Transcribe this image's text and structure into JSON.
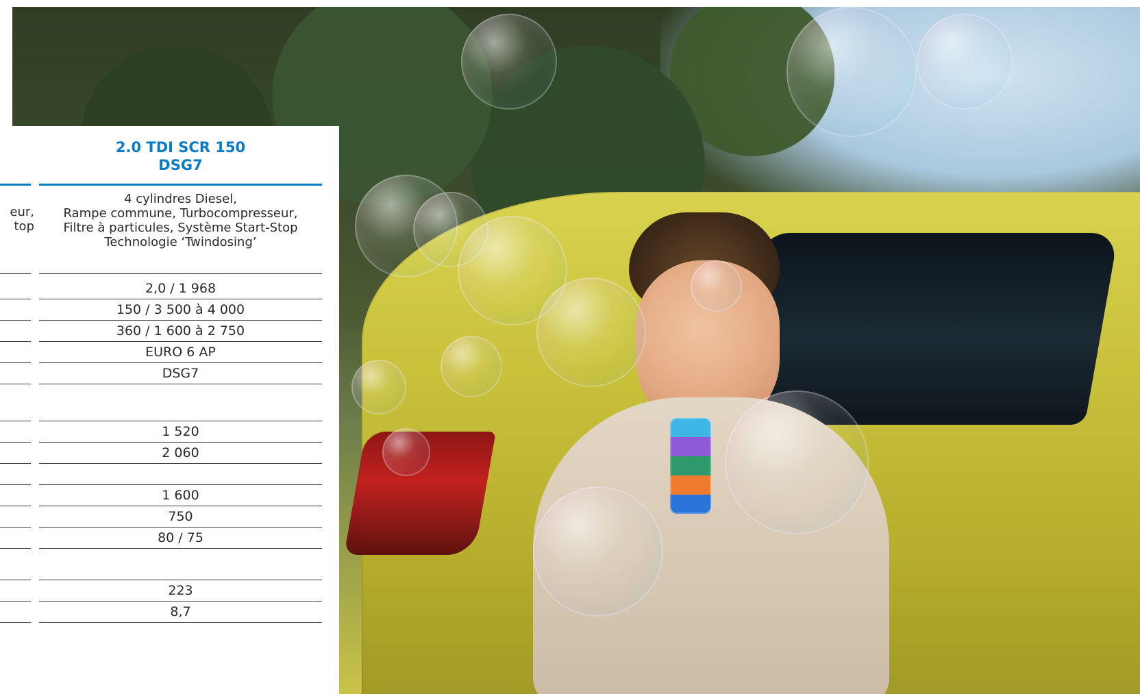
{
  "spec_table": {
    "left_partial": {
      "engine_desc_fragment": "eur,\ntop"
    },
    "column": {
      "header": "2.0 TDI SCR 150\nDSG7",
      "engine_description": "4 cylindres Diesel,\nRampe commune, Turbocompresseur,\nFiltre à particules, Système Start-Stop\nTechnologie ‘Twindosing’",
      "rows": [
        "",
        "2,0 / 1 968",
        "150 / 3 500 à 4 000",
        "360 / 1 600 à 2 750",
        "EURO 6 AP",
        "DSG7",
        "",
        "1 520",
        "2 060",
        "",
        "1 600",
        "750",
        "80 / 75",
        "",
        "223",
        "8,7"
      ]
    },
    "colors": {
      "accent": "#0a7cc6",
      "rule": "#3d3d3d"
    }
  },
  "photo": {
    "scene": "child-blowing-bubbles-yellow-car"
  }
}
